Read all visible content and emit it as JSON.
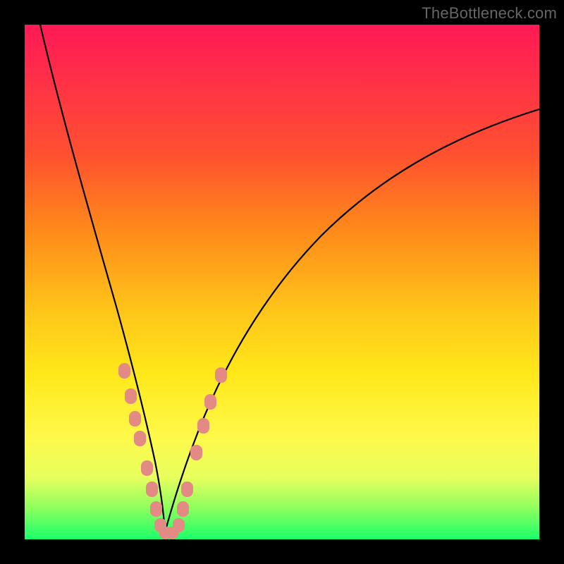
{
  "watermark": "TheBottleneck.com",
  "colors": {
    "background_frame": "#000000",
    "gradient_top": "#ff1a55",
    "gradient_mid1": "#ff8a1a",
    "gradient_mid2": "#ffe81a",
    "gradient_bottom": "#1aff6a",
    "curve": "#000000",
    "markers": "#e38a85"
  },
  "chart_data": {
    "type": "line",
    "title": "",
    "xlabel": "",
    "ylabel": "",
    "x_range_normalized": [
      0,
      1
    ],
    "y_range_normalized": [
      0,
      1
    ],
    "note": "Axes are unlabeled; values below are normalized pixel-space fractions (x: 0=left, 1=right; y: 0=bottom, 1=top). Curve is a V/funnel shape touching 0 near x≈0.27.",
    "series": [
      {
        "name": "left-branch",
        "x": [
          0.03,
          0.06,
          0.09,
          0.12,
          0.15,
          0.18,
          0.205,
          0.225,
          0.245,
          0.26,
          0.272
        ],
        "y": [
          1.0,
          0.87,
          0.74,
          0.61,
          0.485,
          0.36,
          0.255,
          0.17,
          0.095,
          0.04,
          0.005
        ]
      },
      {
        "name": "right-branch",
        "x": [
          0.272,
          0.295,
          0.32,
          0.35,
          0.39,
          0.44,
          0.5,
          0.57,
          0.65,
          0.74,
          0.83,
          0.92,
          1.0
        ],
        "y": [
          0.005,
          0.06,
          0.13,
          0.21,
          0.3,
          0.395,
          0.48,
          0.56,
          0.635,
          0.7,
          0.755,
          0.8,
          0.835
        ]
      }
    ],
    "markers": {
      "name": "pink-dots",
      "shape": "rounded-rect",
      "approx_size_px": 16,
      "points_normalized": [
        {
          "x": 0.192,
          "y": 0.33
        },
        {
          "x": 0.204,
          "y": 0.28
        },
        {
          "x": 0.213,
          "y": 0.236
        },
        {
          "x": 0.222,
          "y": 0.198
        },
        {
          "x": 0.236,
          "y": 0.14
        },
        {
          "x": 0.246,
          "y": 0.098
        },
        {
          "x": 0.254,
          "y": 0.06
        },
        {
          "x": 0.262,
          "y": 0.028
        },
        {
          "x": 0.272,
          "y": 0.01
        },
        {
          "x": 0.286,
          "y": 0.01
        },
        {
          "x": 0.298,
          "y": 0.028
        },
        {
          "x": 0.306,
          "y": 0.06
        },
        {
          "x": 0.314,
          "y": 0.098
        },
        {
          "x": 0.332,
          "y": 0.17
        },
        {
          "x": 0.346,
          "y": 0.222
        },
        {
          "x": 0.36,
          "y": 0.268
        },
        {
          "x": 0.38,
          "y": 0.32
        }
      ]
    }
  }
}
